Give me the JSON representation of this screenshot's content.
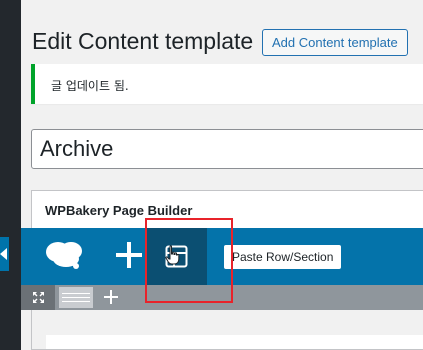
{
  "page": {
    "title": "Edit Content template",
    "add_button_label": "Add Content template"
  },
  "notice": {
    "text": "글 업데이트 됨.",
    "accent_color": "#00a32a"
  },
  "post_title": {
    "value": "Archive"
  },
  "wpbakery": {
    "panel_title": "WPBakery Page Builder",
    "navbar_color": "#0473aa",
    "tooltip": "Paste Row/Section",
    "icons": [
      "wpbakery-logo-icon",
      "add-element-icon",
      "templates-icon",
      "fullscreen-icon",
      "layout-icon",
      "add-row-icon"
    ]
  },
  "annotation": {
    "highlight_color": "#e8232a"
  }
}
